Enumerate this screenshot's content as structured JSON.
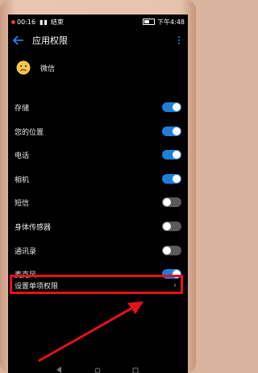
{
  "status_bar": {
    "time": "00:16",
    "carrier": "结束",
    "right_time": "下午4:48"
  },
  "header": {
    "title": "应用权限"
  },
  "app": {
    "name": "微信",
    "icon": "sad-face-icon"
  },
  "permissions": [
    {
      "label": "存储",
      "on": true
    },
    {
      "label": "您的位置",
      "on": true
    },
    {
      "label": "电话",
      "on": true
    },
    {
      "label": "相机",
      "on": true
    },
    {
      "label": "短信",
      "on": false
    },
    {
      "label": "身体传感器",
      "on": false
    },
    {
      "label": "通讯录",
      "on": false
    },
    {
      "label": "麦克风",
      "on": true
    }
  ],
  "single_permission": {
    "label": "设置单项权限",
    "chevron": "›"
  },
  "colors": {
    "accent": "#1e7fd9",
    "highlight": "#e8101a",
    "background": "#000000"
  }
}
